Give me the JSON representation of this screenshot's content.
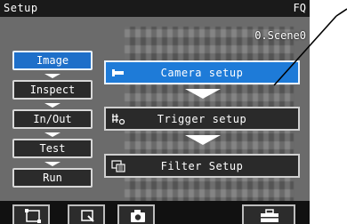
{
  "titlebar": {
    "left": "Setup",
    "right": "FQ"
  },
  "scene_label": "0.Scene0",
  "sidebar": {
    "items": [
      {
        "label": "Image",
        "active": true
      },
      {
        "label": "Inspect",
        "active": false
      },
      {
        "label": "In/Out",
        "active": false
      },
      {
        "label": "Test",
        "active": false
      },
      {
        "label": "Run",
        "active": false
      }
    ]
  },
  "main": {
    "buttons": [
      {
        "label": "Camera setup",
        "icon": "camera-setup-icon",
        "active": true
      },
      {
        "label": "Trigger setup",
        "icon": "trigger-icon",
        "active": false
      },
      {
        "label": "Filter Setup",
        "icon": "filter-icon",
        "active": false
      }
    ]
  },
  "toolbar": {
    "icons": [
      "frame-icon",
      "zoom-icon",
      "camera-icon",
      "toolbox-icon"
    ]
  },
  "colors": {
    "active": "#1e7bd8",
    "background": "#6b6b6b",
    "bar": "#1a1a1a"
  }
}
